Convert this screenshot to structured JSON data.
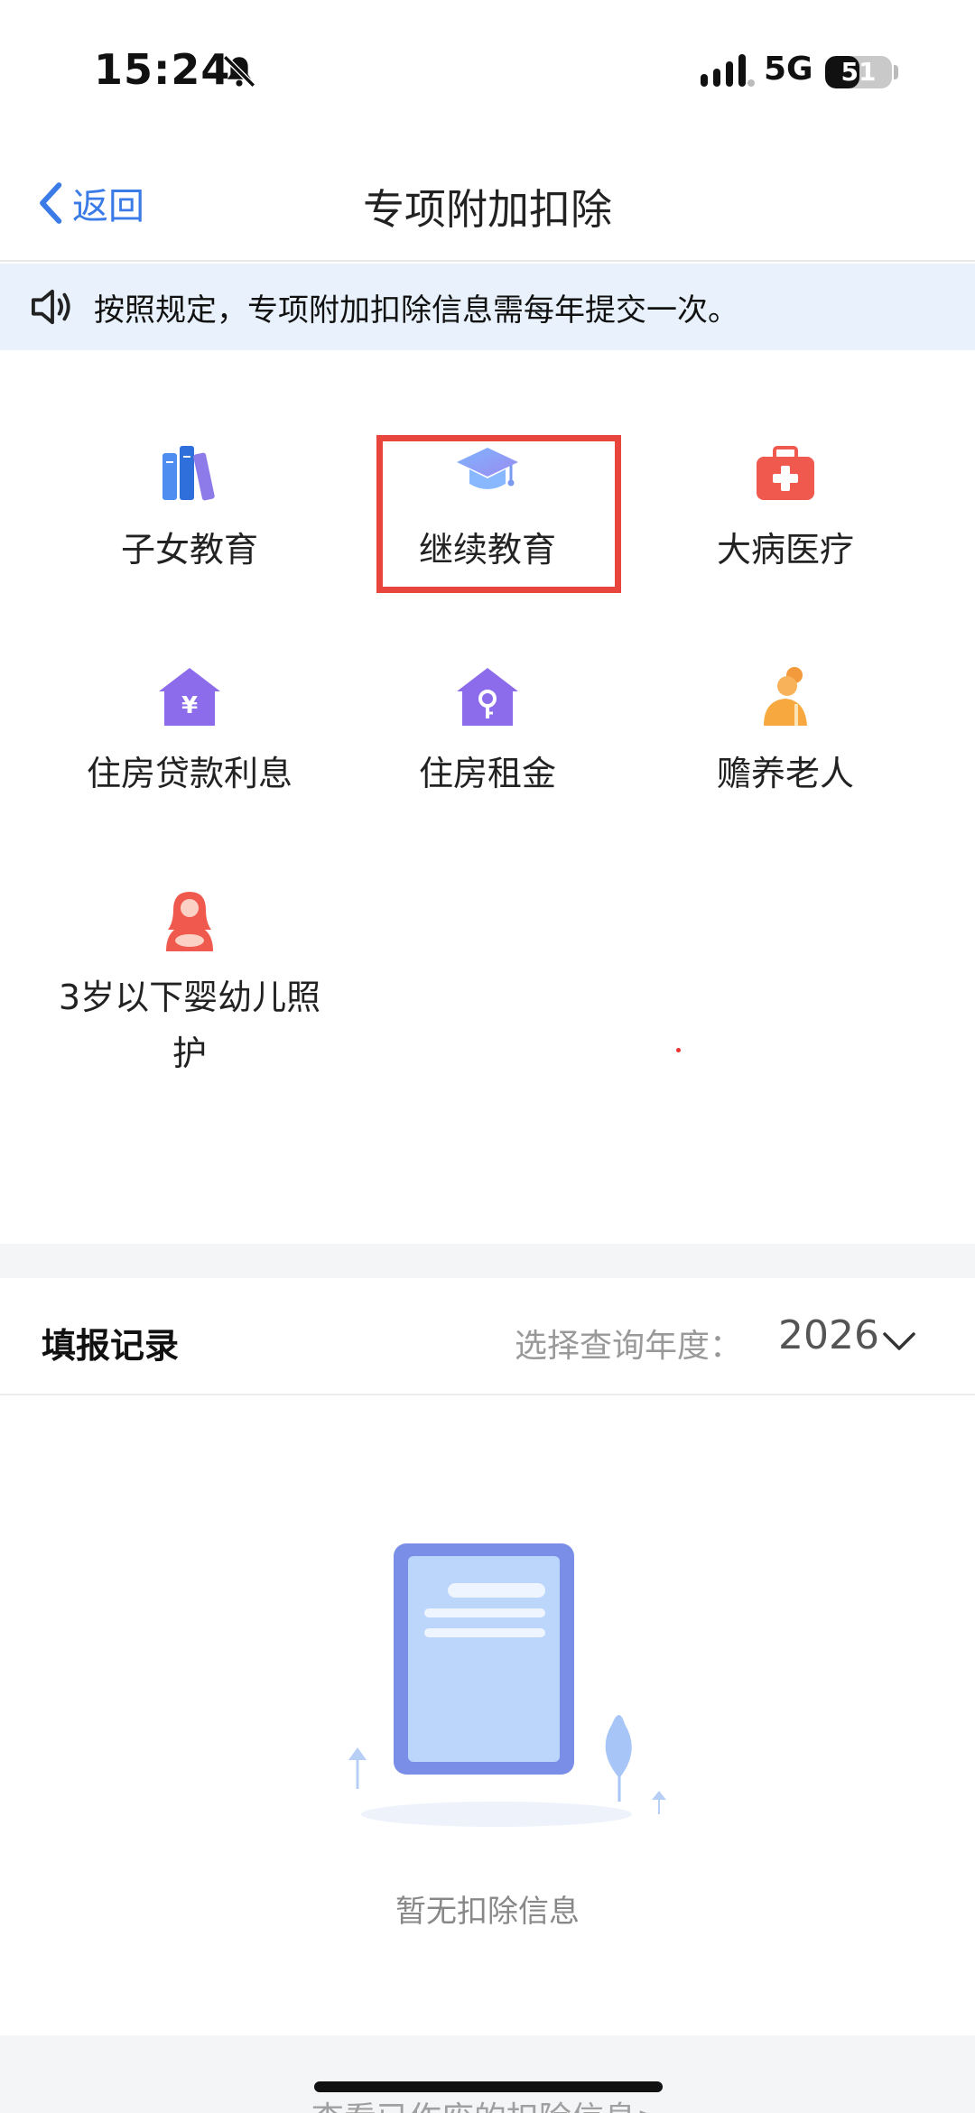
{
  "status_bar": {
    "time": "15:24",
    "network": "5G",
    "battery": "51",
    "battery_level": 0.51
  },
  "nav": {
    "back_label": "返回",
    "title": "专项附加扣除"
  },
  "notice": {
    "text": "按照规定，专项附加扣除信息需每年提交一次。"
  },
  "deductions": [
    {
      "label": "子女教育",
      "icon": "books-icon"
    },
    {
      "label": "继续教育",
      "icon": "graduation-cap-icon"
    },
    {
      "label": "大病医疗",
      "icon": "medical-kit-icon"
    },
    {
      "label": "住房贷款利息",
      "icon": "house-yuan-icon"
    },
    {
      "label": "住房租金",
      "icon": "house-key-icon"
    },
    {
      "label": "赡养老人",
      "icon": "elderly-icon"
    },
    {
      "label_line1": "3岁以下婴幼儿照",
      "label_line2": "护",
      "icon": "mother-baby-icon"
    }
  ],
  "records": {
    "title": "填报记录",
    "year_label": "选择查询年度：",
    "year_value": "2026"
  },
  "empty": {
    "text": "暂无扣除信息"
  },
  "footer": {
    "link": "查看已作废的扣除信息>"
  },
  "colors": {
    "accent": "#3b7be8",
    "highlight": "#e8453c",
    "notice_bg": "#e9f2fc"
  }
}
